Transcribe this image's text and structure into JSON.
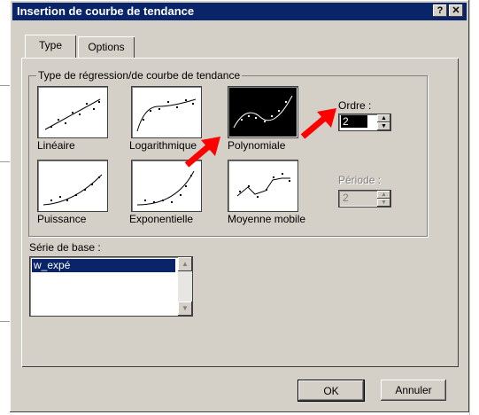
{
  "window": {
    "title": "Insertion de courbe de tendance",
    "help_label": "?",
    "close_label": "✕"
  },
  "tabs": [
    {
      "label": "Type"
    },
    {
      "label": "Options"
    }
  ],
  "regression_group": {
    "legend": "Type de régression/de courbe de tendance",
    "types": [
      {
        "label": "Linéaire",
        "selected": false
      },
      {
        "label": "Logarithmique",
        "selected": false
      },
      {
        "label": "Polynomiale",
        "selected": true
      },
      {
        "label": "Puissance",
        "selected": false
      },
      {
        "label": "Exponentielle",
        "selected": false
      },
      {
        "label": "Moyenne mobile",
        "selected": false
      }
    ]
  },
  "ordre": {
    "label": "Ordre :",
    "value": "2",
    "enabled": true
  },
  "periode": {
    "label": "Période :",
    "value": "2",
    "enabled": false
  },
  "serie_de_base": {
    "label": "Série de base :",
    "items": [
      "w_expé"
    ],
    "selected": "w_expé"
  },
  "buttons": {
    "ok": "OK",
    "cancel": "Annuler"
  },
  "colors": {
    "titlebar": "#0a246a",
    "face": "#d4d0c8",
    "annotation_arrow": "#ff0000"
  },
  "annotations": [
    {
      "type": "red-arrow",
      "points_to": "Polynomiale"
    },
    {
      "type": "red-arrow",
      "points_to": "Ordre"
    }
  ]
}
